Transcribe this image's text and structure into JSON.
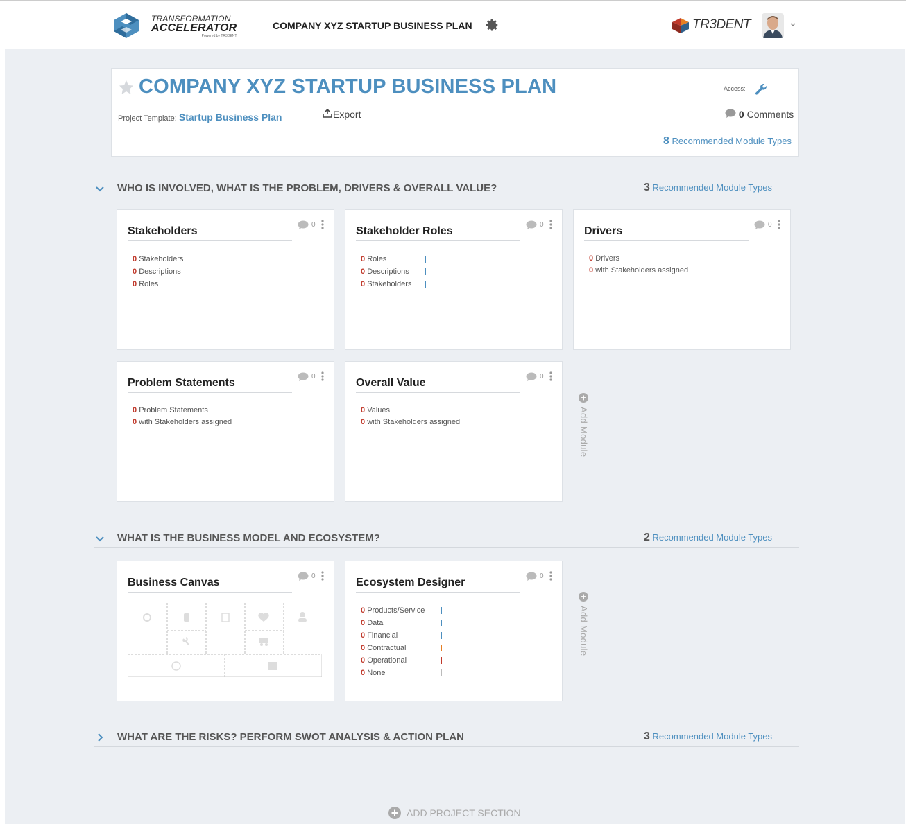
{
  "topbar": {
    "brand_line1": "TRANSFORMATION",
    "brand_line2": "ACCELERATOR",
    "brand_line3": "Powered by TR3DENT",
    "project_title": "COMPANY XYZ STARTUP BUSINESS PLAN",
    "company_logo_text": "TR3DENT",
    "icons": [
      "transformation-accelerator-logo",
      "gear-icon",
      "tr3dent-logo",
      "user-avatar",
      "chevron-down-icon"
    ]
  },
  "header": {
    "title": "COMPANY XYZ STARTUP BUSINESS PLAN",
    "access_label": "Access:",
    "template_label": "Project Template:",
    "template_name": "Startup Business Plan",
    "export_label": "Export",
    "comments_count": "0",
    "comments_label": "Comments",
    "recommended_count": "8",
    "recommended_label": "Recommended Module Types"
  },
  "sections": [
    {
      "title": "WHO IS INVOLVED, WHAT IS THE PROBLEM, DRIVERS & OVERALL VALUE?",
      "recommended_count": "3",
      "recommended_label": "Recommended Module Types",
      "modules": [
        {
          "title": "Stakeholders",
          "comments": "0",
          "stats": [
            {
              "num": "0",
              "label": "Stakeholders"
            },
            {
              "num": "0",
              "label": "Descriptions"
            },
            {
              "num": "0",
              "label": "Roles"
            }
          ]
        },
        {
          "title": "Stakeholder Roles",
          "comments": "0",
          "stats": [
            {
              "num": "0",
              "label": "Roles"
            },
            {
              "num": "0",
              "label": "Descriptions"
            },
            {
              "num": "0",
              "label": "Stakeholders"
            }
          ]
        },
        {
          "title": "Drivers",
          "comments": "0",
          "stats": [
            {
              "num": "0",
              "label": "Drivers"
            },
            {
              "num": "0",
              "label": "with Stakeholders assigned"
            }
          ]
        },
        {
          "title": "Problem Statements",
          "comments": "0",
          "stats": [
            {
              "num": "0",
              "label": "Problem Statements"
            },
            {
              "num": "0",
              "label": "with Stakeholders assigned"
            }
          ]
        },
        {
          "title": "Overall Value",
          "comments": "0",
          "stats": [
            {
              "num": "0",
              "label": "Values"
            },
            {
              "num": "0",
              "label": "with Stakeholders assigned"
            }
          ]
        }
      ],
      "add_module_label": "Add Module"
    },
    {
      "title": "WHAT IS THE BUSINESS MODEL AND ECOSYSTEM?",
      "recommended_count": "2",
      "recommended_label": "Recommended Module Types",
      "modules": [
        {
          "title": "Business Canvas",
          "comments": "0"
        },
        {
          "title": "Ecosystem Designer",
          "comments": "0",
          "stats": [
            {
              "num": "0",
              "label": "Products/Service"
            },
            {
              "num": "0",
              "label": "Data"
            },
            {
              "num": "0",
              "label": "Financial"
            },
            {
              "num": "0",
              "label": "Contractual"
            },
            {
              "num": "0",
              "label": "Operational"
            },
            {
              "num": "0",
              "label": "None"
            }
          ]
        }
      ],
      "add_module_label": "Add Module"
    },
    {
      "title": "WHAT ARE THE RISKS? PERFORM SWOT ANALYSIS & ACTION PLAN",
      "recommended_count": "3",
      "recommended_label": "Recommended Module Types"
    }
  ],
  "add_section_label": "ADD PROJECT SECTION",
  "colors": {
    "accent": "#4d8fbf",
    "stat_number": "#c0392b",
    "background": "#eceff3",
    "ecosystem_bars": [
      "#4d8fbf",
      "#4d8fbf",
      "#4d8fbf",
      "#e67e22",
      "#c0392b",
      "#bbbbbb"
    ]
  }
}
